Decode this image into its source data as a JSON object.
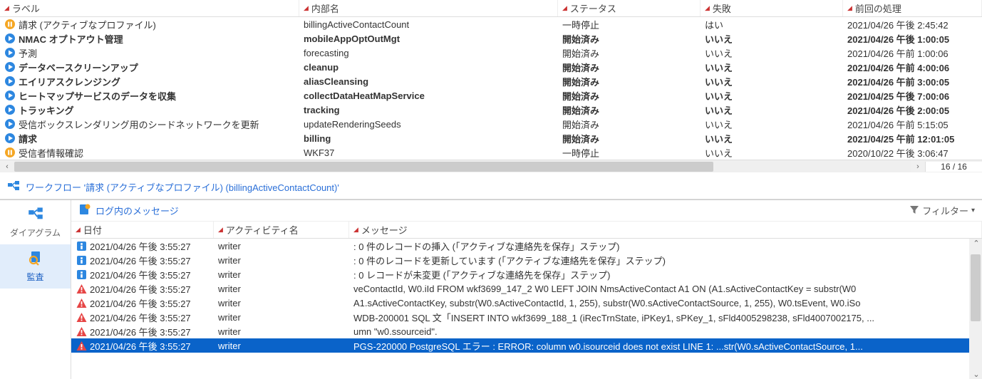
{
  "gridHeaders": {
    "label": "ラベル",
    "internal": "内部名",
    "status": "ステータス",
    "fail": "失敗",
    "last": "前回の処理"
  },
  "rows": [
    {
      "icon": "pause",
      "bold": false,
      "label": "請求 (アクティブなプロファイル)",
      "internal": "billingActiveContactCount",
      "status": "一時停止",
      "fail": "はい",
      "last": "2021/04/26 午後 2:45:42"
    },
    {
      "icon": "play",
      "bold": true,
      "label": "NMAC オプトアウト管理",
      "internal": "mobileAppOptOutMgt",
      "status": "開始済み",
      "fail": "いいえ",
      "last": "2021/04/26 午後 1:00:05"
    },
    {
      "icon": "play",
      "bold": false,
      "label": "予測",
      "internal": "forecasting",
      "status": "開始済み",
      "fail": "いいえ",
      "last": "2021/04/26 午前 1:00:06"
    },
    {
      "icon": "play",
      "bold": true,
      "label": "データベースクリーンアップ",
      "internal": "cleanup",
      "status": "開始済み",
      "fail": "いいえ",
      "last": "2021/04/26 午前 4:00:06"
    },
    {
      "icon": "play",
      "bold": true,
      "label": "エイリアスクレンジング",
      "internal": "aliasCleansing",
      "status": "開始済み",
      "fail": "いいえ",
      "last": "2021/04/26 午前 3:00:05"
    },
    {
      "icon": "play",
      "bold": true,
      "label": "ヒートマップサービスのデータを収集",
      "internal": "collectDataHeatMapService",
      "status": "開始済み",
      "fail": "いいえ",
      "last": "2021/04/25 午後 7:00:06"
    },
    {
      "icon": "play",
      "bold": true,
      "label": "トラッキング",
      "internal": "tracking",
      "status": "開始済み",
      "fail": "いいえ",
      "last": "2021/04/26 午後 2:00:05"
    },
    {
      "icon": "play",
      "bold": false,
      "label": "受信ボックスレンダリング用のシードネットワークを更新",
      "internal": "updateRenderingSeeds",
      "status": "開始済み",
      "fail": "いいえ",
      "last": "2021/04/26 午前 5:15:05"
    },
    {
      "icon": "play",
      "bold": true,
      "label": "請求",
      "internal": "billing",
      "status": "開始済み",
      "fail": "いいえ",
      "last": "2021/04/25 午前 12:01:05"
    },
    {
      "icon": "pause",
      "bold": false,
      "label": "受信者情報確認",
      "internal": "WKF37",
      "status": "一時停止",
      "fail": "いいえ",
      "last": "2020/10/22 午後 3:06:47"
    }
  ],
  "counter": "16 / 16",
  "breadcrumb": "ワークフロー '請求 (アクティブなプロファイル) (billingActiveContactCount)'",
  "sidebar": {
    "diagram": "ダイアグラム",
    "audit": "監査"
  },
  "logToolbar": {
    "messages": "ログ内のメッセージ",
    "filter": "フィルター"
  },
  "logHeaders": {
    "date": "日付",
    "activity": "アクティビティ名",
    "message": "メッセージ"
  },
  "logRows": [
    {
      "icon": "info",
      "sel": false,
      "date": "2021/04/26 午後 3:55:27",
      "act": "writer",
      "msg": ": 0 件のレコードの挿入 (「アクティブな連絡先を保存」ステップ)"
    },
    {
      "icon": "info",
      "sel": false,
      "date": "2021/04/26 午後 3:55:27",
      "act": "writer",
      "msg": ": 0 件のレコードを更新しています (「アクティブな連絡先を保存」ステップ)"
    },
    {
      "icon": "info",
      "sel": false,
      "date": "2021/04/26 午後 3:55:27",
      "act": "writer",
      "msg": ": 0 レコードが未変更 (「アクティブな連絡先を保存」ステップ)"
    },
    {
      "icon": "warn",
      "sel": false,
      "date": "2021/04/26 午後 3:55:27",
      "act": "writer",
      "msg": "veContactId, W0.iId FROM wkf3699_147_2 W0 LEFT JOIN NmsActiveContact A1 ON (A1.sActiveContactKey = substr(W0"
    },
    {
      "icon": "warn",
      "sel": false,
      "date": "2021/04/26 午後 3:55:27",
      "act": "writer",
      "msg": "A1.sActiveContactKey, substr(W0.sActiveContactId, 1, 255), substr(W0.sActiveContactSource, 1, 255), W0.tsEvent, W0.iSo"
    },
    {
      "icon": "warn",
      "sel": false,
      "date": "2021/04/26 午後 3:55:27",
      "act": "writer",
      "msg": "WDB-200001 SQL 文「INSERT INTO wkf3699_188_1 (iRecTrnState, iPKey1, sPKey_1, sFld4005298238, sFld4007002175, ..."
    },
    {
      "icon": "warn",
      "sel": false,
      "date": "2021/04/26 午後 3:55:27",
      "act": "writer",
      "msg": "umn \"w0.ssourceid\"."
    },
    {
      "icon": "warn",
      "sel": true,
      "date": "2021/04/26 午後 3:55:27",
      "act": "writer",
      "msg": "PGS-220000 PostgreSQL エラー : ERROR:  column w0.isourceid does not exist LINE 1: ...str(W0.sActiveContactSource, 1..."
    }
  ]
}
